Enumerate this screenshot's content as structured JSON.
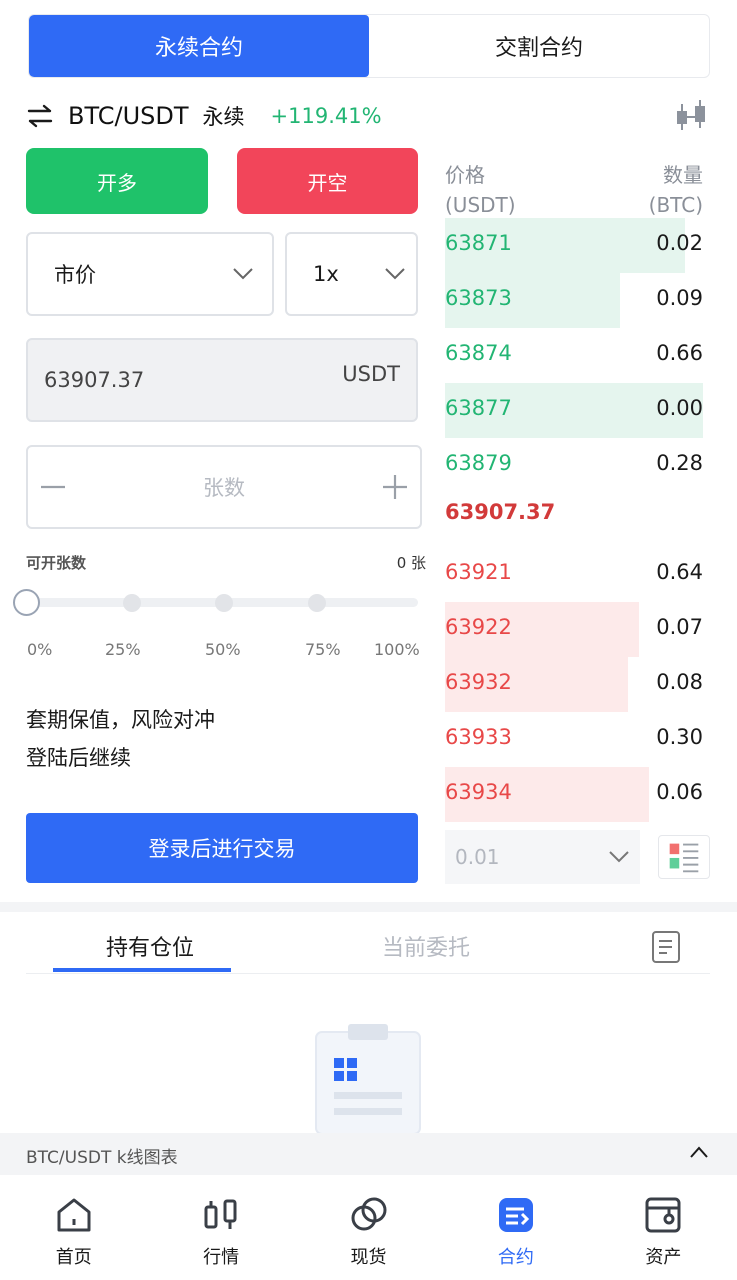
{
  "contract_tabs": {
    "perpetual": "永续合约",
    "delivery": "交割合约"
  },
  "pair": {
    "name": "BTC/USDT",
    "type": "永续",
    "change": "+119.41%"
  },
  "actions": {
    "long": "开多",
    "short": "开空"
  },
  "order_form": {
    "order_type": "市价",
    "leverage": "1x",
    "price": "63907.37",
    "price_unit": "USDT",
    "qty_placeholder": "张数",
    "available_label": "可开张数",
    "available_value": "0 张",
    "slider_labels": [
      "0%",
      "25%",
      "50%",
      "75%",
      "100%"
    ],
    "slider_value_percent": 0
  },
  "promo": {
    "line1": "套期保值，风险对冲",
    "line2": "登陆后继续"
  },
  "login_button": "登录后进行交易",
  "orderbook": {
    "price_header": "价格",
    "price_unit": "(USDT)",
    "qty_header": "数量",
    "qty_unit": "(BTC)",
    "bids": [
      {
        "price": "63871",
        "qty": "0.02",
        "depth": 0.93
      },
      {
        "price": "63873",
        "qty": "0.09",
        "depth": 0.68
      },
      {
        "price": "63874",
        "qty": "0.66",
        "depth": 0
      },
      {
        "price": "63877",
        "qty": "0.00",
        "depth": 1.0
      },
      {
        "price": "63879",
        "qty": "0.28",
        "depth": 0
      }
    ],
    "mid_price": "63907.37",
    "asks": [
      {
        "price": "63921",
        "qty": "0.64",
        "depth": 0
      },
      {
        "price": "63922",
        "qty": "0.07",
        "depth": 0.75
      },
      {
        "price": "63932",
        "qty": "0.08",
        "depth": 0.71
      },
      {
        "price": "63933",
        "qty": "0.30",
        "depth": 0
      },
      {
        "price": "63934",
        "qty": "0.06",
        "depth": 0.79
      }
    ],
    "depth_step": "0.01"
  },
  "positions_tabs": {
    "holding": "持有仓位",
    "orders": "当前委托"
  },
  "kline_bar": {
    "label": "BTC/USDT k线图表"
  },
  "nav": [
    {
      "label": "首页",
      "icon": "home-icon"
    },
    {
      "label": "行情",
      "icon": "candlestick-icon"
    },
    {
      "label": "现货",
      "icon": "spot-icon"
    },
    {
      "label": "合约",
      "icon": "contract-icon"
    },
    {
      "label": "资产",
      "icon": "wallet-icon"
    }
  ],
  "colors": {
    "accent": "#2f6af5",
    "up": "#1fc26a",
    "down": "#f2455a"
  }
}
